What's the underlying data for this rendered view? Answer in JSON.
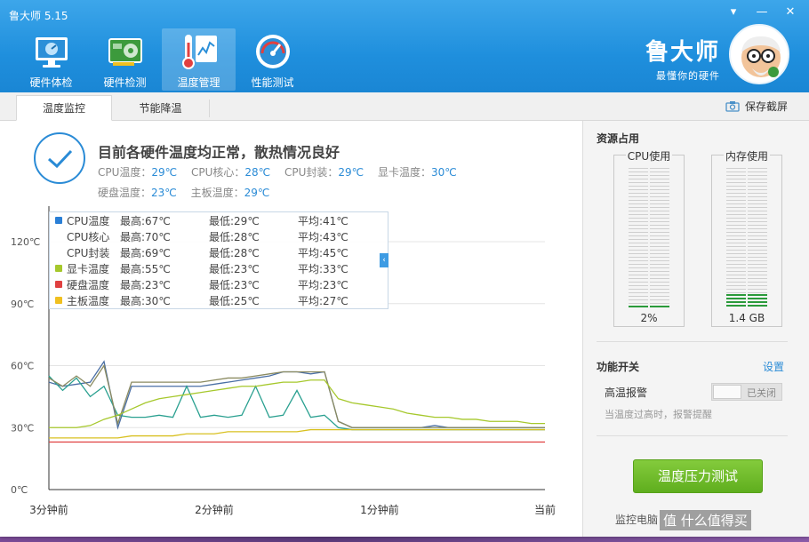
{
  "app": {
    "title": "鲁大师 5.15"
  },
  "window_controls": {
    "menu": "▾",
    "minimize": "—",
    "close": "✕"
  },
  "nav": [
    {
      "label": "硬件体检",
      "icon": "monitor-icon"
    },
    {
      "label": "硬件检测",
      "icon": "graphics-card-icon"
    },
    {
      "label": "温度管理",
      "icon": "thermometer-icon",
      "active": true
    },
    {
      "label": "性能测试",
      "icon": "speedometer-icon"
    }
  ],
  "brand": {
    "name": "鲁大师",
    "slogan": "最懂你的硬件"
  },
  "subtabs": {
    "monitor": "温度监控",
    "cooling": "节能降温",
    "screenshot": "保存截屏"
  },
  "status": {
    "title": "目前各硬件温度均正常，散热情况良好",
    "readings": [
      {
        "label": "CPU温度：",
        "value": "29℃"
      },
      {
        "label": "CPU核心：",
        "value": "28℃"
      },
      {
        "label": "CPU封装：",
        "value": "29℃"
      },
      {
        "label": "显卡温度：",
        "value": "30℃"
      },
      {
        "label": "硬盘温度：",
        "value": "23℃"
      },
      {
        "label": "主板温度：",
        "value": "29℃"
      }
    ]
  },
  "legend": [
    {
      "name": "CPU温度",
      "max": "最高:67℃",
      "min": "最低:29℃",
      "avg": "平均:41℃",
      "color": "#2a7fd6"
    },
    {
      "name": "CPU核心",
      "max": "最高:70℃",
      "min": "最低:28℃",
      "avg": "平均:43℃",
      "color": ""
    },
    {
      "name": "CPU封装",
      "max": "最高:69℃",
      "min": "最低:28℃",
      "avg": "平均:45℃",
      "color": ""
    },
    {
      "name": "显卡温度",
      "max": "最高:55℃",
      "min": "最低:23℃",
      "avg": "平均:33℃",
      "color": "#a6c82c"
    },
    {
      "name": "硬盘温度",
      "max": "最高:23℃",
      "min": "最低:23℃",
      "avg": "平均:23℃",
      "color": "#e04040"
    },
    {
      "name": "主板温度",
      "max": "最高:30℃",
      "min": "最低:25℃",
      "avg": "平均:27℃",
      "color": "#f0c020"
    }
  ],
  "chart_data": {
    "type": "line",
    "ylim": [
      0,
      120
    ],
    "yticks": [
      "0℃",
      "30℃",
      "60℃",
      "90℃",
      "120℃"
    ],
    "xticks": [
      "3分钟前",
      "2分钟前",
      "1分钟前",
      "当前"
    ],
    "x": [
      0,
      5,
      10,
      15,
      20,
      25,
      30,
      35,
      40,
      45,
      50,
      55,
      60,
      65,
      70,
      75,
      80,
      85,
      90,
      95,
      100,
      105,
      110,
      115,
      120,
      125,
      130,
      135,
      140,
      145,
      150,
      155,
      160,
      165,
      170,
      175,
      180
    ],
    "series": [
      {
        "name": "CPU温度",
        "color": "#4a6fa5",
        "values": [
          52,
          50,
          51,
          52,
          62,
          30,
          50,
          50,
          50,
          50,
          50,
          50,
          51,
          52,
          53,
          54,
          55,
          57,
          57,
          56,
          57,
          33,
          30,
          30,
          30,
          30,
          30,
          30,
          31,
          30,
          30,
          30,
          30,
          30,
          30,
          30,
          30
        ]
      },
      {
        "name": "CPU核心",
        "color": "#2aa090",
        "values": [
          55,
          48,
          54,
          45,
          50,
          36,
          35,
          35,
          36,
          35,
          50,
          35,
          36,
          35,
          36,
          50,
          35,
          36,
          48,
          35,
          36,
          30,
          29,
          29,
          29,
          29,
          29,
          29,
          29,
          29,
          29,
          29,
          29,
          29,
          29,
          29,
          29
        ]
      },
      {
        "name": "CPU封装",
        "color": "#8a8a60",
        "values": [
          54,
          50,
          55,
          50,
          60,
          32,
          52,
          52,
          52,
          52,
          52,
          52,
          53,
          54,
          54,
          55,
          56,
          57,
          57,
          57,
          57,
          33,
          30,
          30,
          30,
          30,
          30,
          30,
          30,
          30,
          30,
          30,
          30,
          30,
          30,
          30,
          30
        ]
      },
      {
        "name": "显卡温度",
        "color": "#a6c82c",
        "values": [
          30,
          30,
          30,
          31,
          34,
          36,
          39,
          42,
          44,
          45,
          46,
          47,
          48,
          49,
          50,
          50,
          51,
          52,
          52,
          53,
          53,
          44,
          42,
          41,
          40,
          39,
          37,
          36,
          35,
          35,
          34,
          34,
          33,
          33,
          33,
          32,
          32
        ]
      },
      {
        "name": "硬盘温度",
        "color": "#e04040",
        "values": [
          23,
          23,
          23,
          23,
          23,
          23,
          23,
          23,
          23,
          23,
          23,
          23,
          23,
          23,
          23,
          23,
          23,
          23,
          23,
          23,
          23,
          23,
          23,
          23,
          23,
          23,
          23,
          23,
          23,
          23,
          23,
          23,
          23,
          23,
          23,
          23,
          23
        ]
      },
      {
        "name": "主板温度",
        "color": "#d8c020",
        "values": [
          25,
          25,
          25,
          25,
          25,
          25,
          26,
          26,
          26,
          26,
          27,
          27,
          27,
          28,
          28,
          28,
          28,
          28,
          28,
          29,
          29,
          29,
          29,
          29,
          29,
          29,
          29,
          29,
          29,
          29,
          29,
          29,
          29,
          29,
          29,
          29,
          29
        ]
      }
    ]
  },
  "resources": {
    "title": "资源占用",
    "cpu": {
      "label": "CPU使用",
      "value": "2%",
      "fraction": 0.02
    },
    "mem": {
      "label": "内存使用",
      "value": "1.4 GB",
      "fraction": 0.1
    }
  },
  "functions": {
    "title": "功能开关",
    "settings": "设置",
    "alarm_label": "高温报警",
    "alarm_state": "已关闭",
    "alarm_desc": "当温度过高时，报警提醒"
  },
  "stress_button": "温度压力测试",
  "footer": {
    "text": "监控电脑"
  },
  "watermark": "值 什么值得买"
}
